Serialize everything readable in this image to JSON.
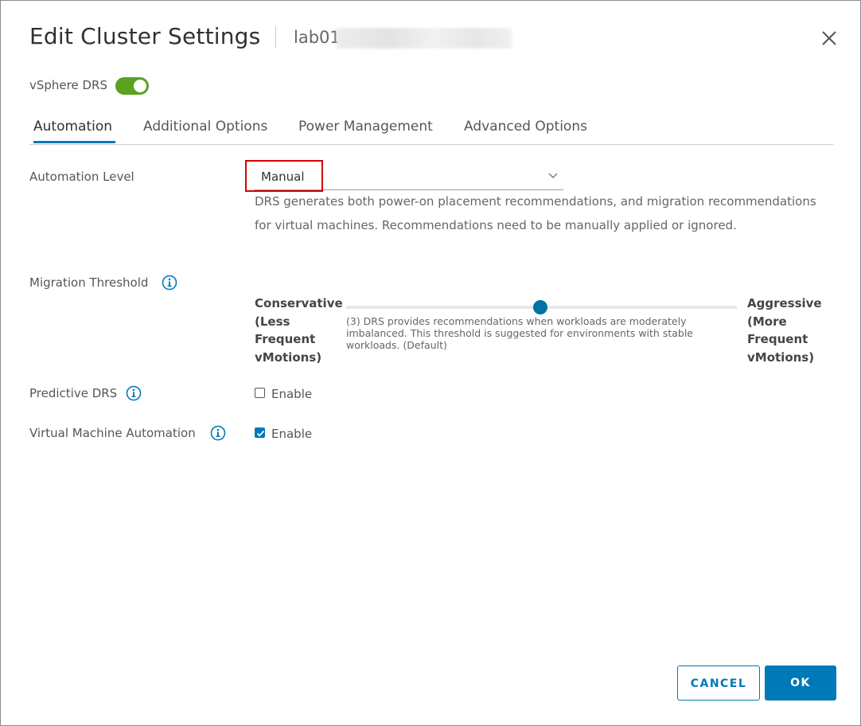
{
  "dialog": {
    "title": "Edit Cluster Settings",
    "subtitle": "lab01",
    "close_icon": "close-icon"
  },
  "drs": {
    "label": "vSphere DRS",
    "enabled": true,
    "toggle_color": "#5aa220"
  },
  "tabs": [
    {
      "label": "Automation",
      "active": true
    },
    {
      "label": "Additional Options",
      "active": false
    },
    {
      "label": "Power Management",
      "active": false
    },
    {
      "label": "Advanced Options",
      "active": false
    }
  ],
  "automation_level": {
    "label": "Automation Level",
    "value": "Manual",
    "description": "DRS generates both power-on placement recommendations, and migration recommendations for virtual machines. Recommendations need to be manually applied or ignored."
  },
  "migration_threshold": {
    "label": "Migration Threshold",
    "left_label": "Conservative (Less Frequent vMotions)",
    "right_label": "Aggressive (More Frequent vMotions)",
    "level": 3,
    "levels": 5,
    "description": "(3) DRS provides recommendations when workloads are moderately imbalanced. This threshold is suggested for environments with stable workloads. (Default)"
  },
  "predictive_drs": {
    "label": "Predictive DRS",
    "option_label": "Enable",
    "checked": false
  },
  "vm_automation": {
    "label": "Virtual Machine Automation",
    "option_label": "Enable",
    "checked": true
  },
  "buttons": {
    "cancel": "CANCEL",
    "ok": "OK"
  },
  "colors": {
    "accent": "#0079b8",
    "highlight_box": "#d40000"
  }
}
